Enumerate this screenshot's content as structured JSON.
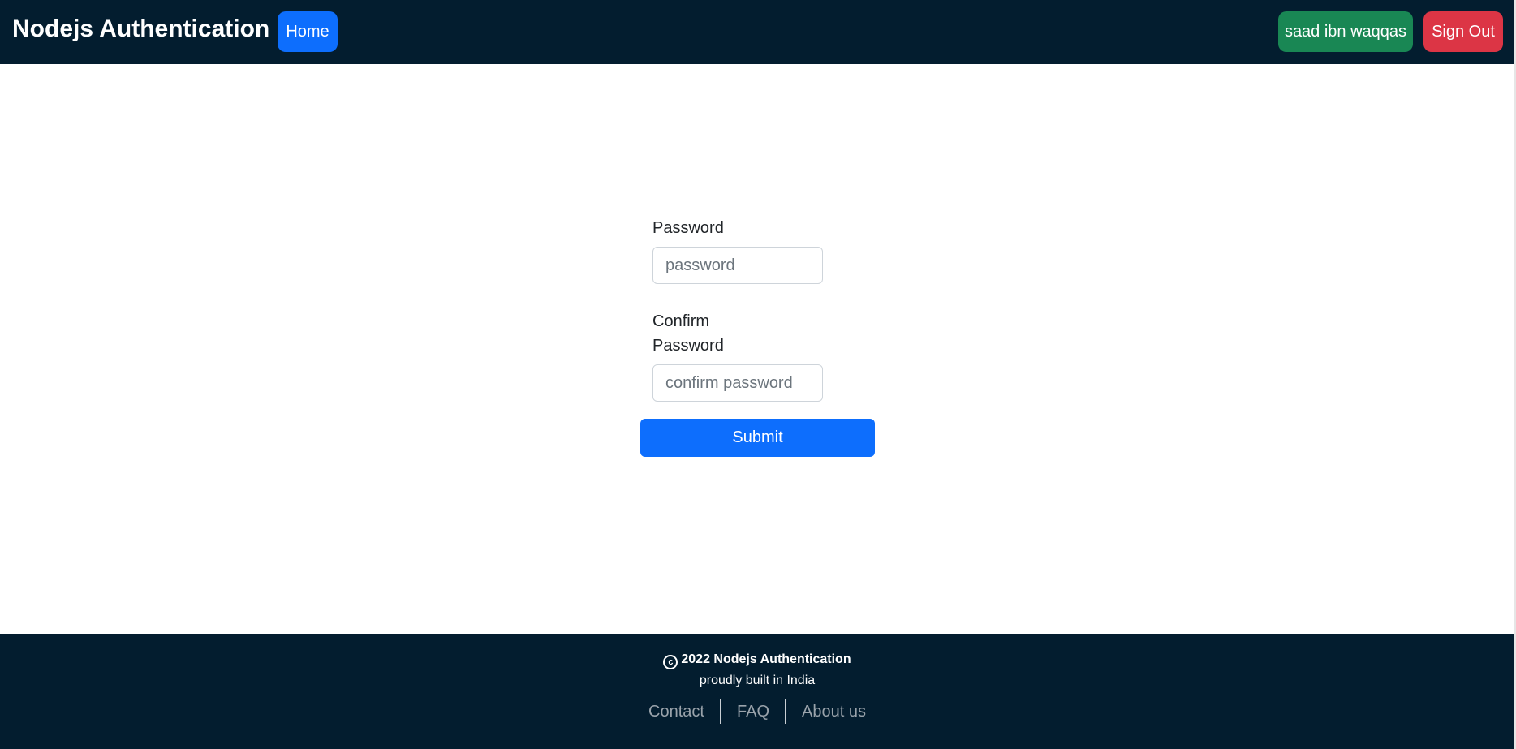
{
  "header": {
    "brand": "Nodejs Authentication",
    "home_label": "Home",
    "user_label": "saad ibn waqqas",
    "signout_label": "Sign Out"
  },
  "form": {
    "password_label": "Password",
    "password_placeholder": "password",
    "confirm_label": "Confirm Password",
    "confirm_placeholder": "confirm password",
    "submit_label": "Submit"
  },
  "footer": {
    "copyright_symbol": "c",
    "copyright_text": "2022 Nodejs Authentication",
    "tagline": "proudly built in India",
    "links": [
      "Contact",
      "FAQ",
      "About us"
    ]
  },
  "colors": {
    "navbar_bg": "#031d2f",
    "primary": "#0d6efd",
    "success": "#198754",
    "danger": "#dc3545"
  }
}
